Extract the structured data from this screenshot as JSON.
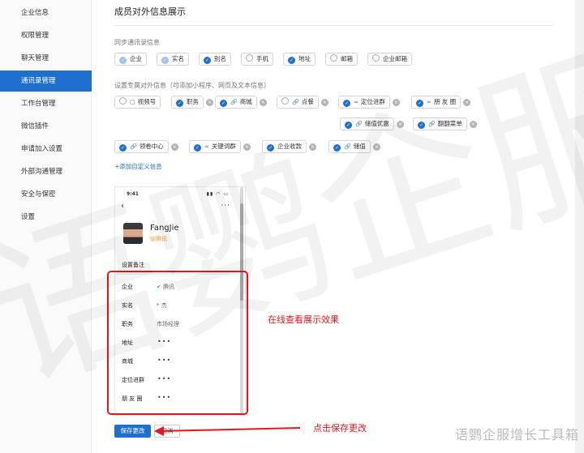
{
  "sidebar": {
    "items": [
      {
        "label": "企业信息",
        "active": false
      },
      {
        "label": "权限管理",
        "active": false
      },
      {
        "label": "聊天管理",
        "active": false
      },
      {
        "label": "通讯录管理",
        "active": true
      },
      {
        "label": "工作台管理",
        "active": false
      },
      {
        "label": "微信插件",
        "active": false
      },
      {
        "label": "申请加入设置",
        "active": false
      },
      {
        "label": "外部沟通管理",
        "active": false
      },
      {
        "label": "安全与保密",
        "active": false
      },
      {
        "label": "设置",
        "active": false
      }
    ]
  },
  "main": {
    "title": "成员对外信息展示",
    "sync_label": "同步通讯录信息",
    "sync_tags": [
      {
        "label": "企业",
        "checked": "light"
      },
      {
        "label": "实名",
        "checked": "light"
      },
      {
        "label": "别名",
        "checked": "on"
      },
      {
        "label": "手机",
        "checked": "off"
      },
      {
        "label": "地址",
        "checked": "on"
      },
      {
        "label": "邮箱",
        "checked": "off"
      },
      {
        "label": "企业邮箱",
        "checked": "off"
      }
    ],
    "custom_label": "设置专属对外信息（可添加小程序、网页及文本信息）",
    "custom_tags": [
      {
        "label": "视频号",
        "icon": "video-icon",
        "checked": "off"
      },
      {
        "label": "职务",
        "icon": "",
        "checked": "on"
      },
      {
        "label": "商城",
        "icon": "link-icon",
        "checked": "on"
      },
      {
        "label": "点餐",
        "icon": "link-icon",
        "checked": "off"
      },
      {
        "label": "定位进群",
        "icon": "miniprogram-icon",
        "checked": "on"
      },
      {
        "label": "朋 友 圈",
        "icon": "miniprogram-icon",
        "checked": "on"
      },
      {
        "label": "储值优惠",
        "icon": "link-icon",
        "checked": "on"
      },
      {
        "label": "翻翻菜单",
        "icon": "link-icon",
        "checked": "on"
      },
      {
        "label": "领卷中心",
        "icon": "link-icon",
        "checked": "on"
      },
      {
        "label": "关键词群",
        "icon": "miniprogram-icon",
        "checked": "on"
      },
      {
        "label": "企业收款",
        "icon": "",
        "checked": "on"
      },
      {
        "label": "储值",
        "icon": "link-icon",
        "checked": "on"
      }
    ],
    "add_link": "+添加自定义信息",
    "save_label": "保存更改",
    "cancel_label": "取消"
  },
  "phone": {
    "time": "9:41",
    "name": "FangJie",
    "company": "@腾讯",
    "remark_label": "设置备注",
    "rows": [
      {
        "label": "企业",
        "value": "腾讯"
      },
      {
        "label": "实名",
        "value": "* 杰"
      },
      {
        "label": "职务",
        "value": "市场经理"
      },
      {
        "label": "地址",
        "value": "•••"
      },
      {
        "label": "商城",
        "value": "•••"
      },
      {
        "label": "定位进群",
        "value": "•••"
      },
      {
        "label": "朋 友 圈",
        "value": "•••"
      }
    ]
  },
  "annotations": {
    "preview_note": "在线查看展示效果",
    "save_note": "点击保存更改",
    "color": "#e5171e"
  },
  "watermark": {
    "big_text": "语鹦企服",
    "bottom_text": "语鹦企服增长工具箱"
  },
  "colors": {
    "accent": "#1f6fd1",
    "annotation": "#e5171e",
    "company_orange": "#f39a1e"
  }
}
